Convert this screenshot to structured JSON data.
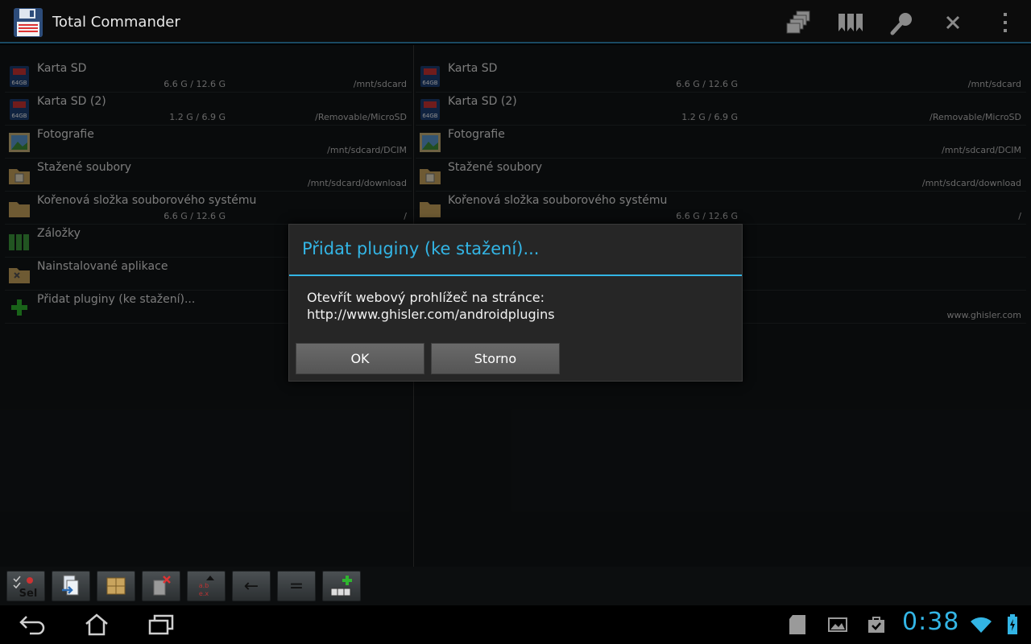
{
  "app": {
    "title": "Total Commander"
  },
  "action_bar": {
    "icons": [
      "multi-window-icon",
      "bookmarks-icon",
      "search-icon",
      "close-icon",
      "overflow-menu-icon"
    ]
  },
  "left_panel": {
    "items": [
      {
        "name": "Karta SD",
        "size": "6.6 G / 12.6 G",
        "path": "/mnt/sdcard",
        "icon": "sd-card-icon"
      },
      {
        "name": "Karta SD (2)",
        "size": "1.2 G / 6.9 G",
        "path": "/Removable/MicroSD",
        "icon": "sd-card-icon"
      },
      {
        "name": "Fotografie",
        "size": "",
        "path": "/mnt/sdcard/DCIM",
        "icon": "photo-icon"
      },
      {
        "name": "Stažené soubory",
        "size": "",
        "path": "/mnt/sdcard/download",
        "icon": "download-folder-icon"
      },
      {
        "name": "Kořenová složka souborového systému",
        "size": "6.6 G / 12.6 G",
        "path": "/",
        "icon": "folder-icon"
      },
      {
        "name": "Záložky",
        "size": "",
        "path": "",
        "icon": "bookmarks-icon"
      },
      {
        "name": "Nainstalované aplikace",
        "size": "",
        "path": "",
        "icon": "apps-folder-icon"
      },
      {
        "name": "Přidat pluginy (ke stažení)...",
        "size": "",
        "path": "",
        "icon": "add-icon"
      }
    ]
  },
  "right_panel": {
    "items": [
      {
        "name": "Karta SD",
        "size": "6.6 G / 12.6 G",
        "path": "/mnt/sdcard",
        "icon": "sd-card-icon"
      },
      {
        "name": "Karta SD (2)",
        "size": "1.2 G / 6.9 G",
        "path": "/Removable/MicroSD",
        "icon": "sd-card-icon"
      },
      {
        "name": "Fotografie",
        "size": "",
        "path": "/mnt/sdcard/DCIM",
        "icon": "photo-icon"
      },
      {
        "name": "Stažené soubory",
        "size": "",
        "path": "/mnt/sdcard/download",
        "icon": "download-folder-icon"
      },
      {
        "name": "Kořenová složka souborového systému",
        "size": "6.6 G / 12.6 G",
        "path": "/",
        "icon": "folder-icon"
      },
      {
        "name": "",
        "size": "",
        "path": "",
        "icon": ""
      },
      {
        "name": "",
        "size": "",
        "path": "",
        "icon": ""
      },
      {
        "name": "",
        "size": "",
        "path": "www.ghisler.com",
        "icon": ""
      }
    ]
  },
  "toolbar": {
    "buttons": [
      {
        "icon": "select-icon",
        "label": "Sel"
      },
      {
        "icon": "copy-icon",
        "label": ""
      },
      {
        "icon": "pack-icon",
        "label": ""
      },
      {
        "icon": "delete-icon",
        "label": ""
      },
      {
        "icon": "sort-icon",
        "label": ""
      },
      {
        "icon": "back-arrow-icon",
        "label": "←"
      },
      {
        "icon": "equal-panels-icon",
        "label": "="
      },
      {
        "icon": "add-button-icon",
        "label": ""
      }
    ]
  },
  "dialog": {
    "title": "Přidat pluginy (ke stažení)...",
    "message": "Otevřít webový prohlížeč na stránce:\nhttp://www.ghisler.com/androidplugins",
    "ok_label": "OK",
    "cancel_label": "Storno"
  },
  "status_bar": {
    "clock": "0:38",
    "icons": [
      "sd-card-icon",
      "gallery-icon",
      "shopping-bag-icon",
      "wifi-icon",
      "battery-icon"
    ]
  },
  "colors": {
    "accent": "#33b5e5",
    "background": "#121517"
  }
}
